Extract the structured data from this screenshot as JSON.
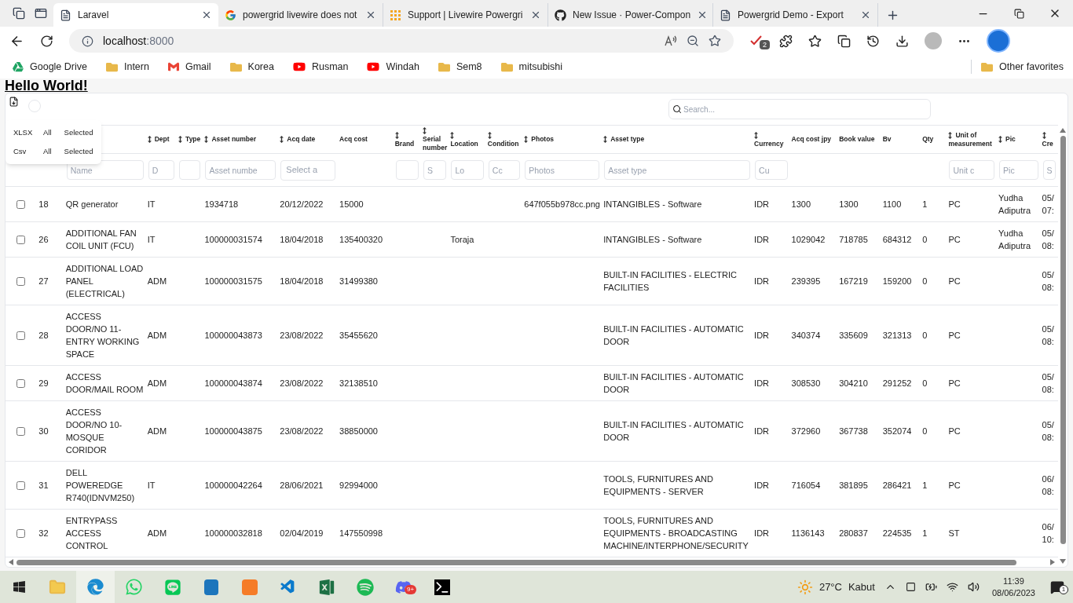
{
  "browser": {
    "tabs": [
      {
        "title": "Laravel",
        "kind": "page",
        "selected": true
      },
      {
        "title": "powergrid livewire does not",
        "kind": "google",
        "selected": false
      },
      {
        "title": "Support | Livewire Powergri",
        "kind": "grid",
        "selected": false
      },
      {
        "title": "New Issue · Power-Compon",
        "kind": "github",
        "selected": false
      },
      {
        "title": "Powergrid Demo - Export",
        "kind": "page",
        "selected": false
      }
    ],
    "address": {
      "host": "localhost",
      "port": ":8000"
    },
    "extension_badge": "2",
    "bookmarks": [
      {
        "label": "Google Drive",
        "kind": "drive"
      },
      {
        "label": "Intern",
        "kind": "folder"
      },
      {
        "label": "Gmail",
        "kind": "gmail"
      },
      {
        "label": "Korea",
        "kind": "folder"
      },
      {
        "label": "Rusman",
        "kind": "youtube"
      },
      {
        "label": "Windah",
        "kind": "youtube"
      },
      {
        "label": "Sem8",
        "kind": "folder"
      },
      {
        "label": "mitsubishi",
        "kind": "folder"
      }
    ],
    "other_favorites": "Other favorites"
  },
  "page": {
    "heading": "Hello World!",
    "export_menu": [
      {
        "format": "XLSX",
        "options": [
          "All",
          "Selected"
        ]
      },
      {
        "format": "Csv",
        "options": [
          "All",
          "Selected"
        ]
      }
    ],
    "search": {
      "placeholder": "Search..."
    },
    "table": {
      "columns": [
        {
          "filter": {
            "kind": "text",
            "placeholder": "Name"
          }
        },
        {
          "label": "Dept",
          "sortable": true,
          "filter": {
            "kind": "text",
            "placeholder": "D"
          }
        },
        {
          "label": "Type",
          "sortable": true,
          "filter": {
            "kind": "text"
          }
        },
        {
          "label": "Asset number",
          "sortable": true,
          "filter": {
            "kind": "text",
            "placeholder": "Asset numbe"
          }
        },
        {
          "label": "Acq date",
          "sortable": true,
          "filter": {
            "kind": "date",
            "placeholder": "Select a"
          }
        },
        {
          "label": "Acq cost",
          "sortable": false
        },
        {
          "label": "Brand",
          "sortable": true,
          "filter": {
            "kind": "text"
          }
        },
        {
          "label": "Serial number",
          "sortable": true,
          "filter": {
            "kind": "text",
            "placeholder": "S"
          }
        },
        {
          "label": "Location",
          "sortable": true,
          "filter": {
            "kind": "text",
            "placeholder": "Lo"
          }
        },
        {
          "label": "Condition",
          "sortable": true,
          "filter": {
            "kind": "text",
            "placeholder": "Cc"
          }
        },
        {
          "label": "Photos",
          "sortable": true,
          "filter": {
            "kind": "text",
            "placeholder": "Photos"
          }
        },
        {
          "label": "Asset type",
          "sortable": true,
          "filter": {
            "kind": "text",
            "placeholder": "Asset type"
          }
        },
        {
          "label": "Currency",
          "sortable": true,
          "filter": {
            "kind": "text",
            "placeholder": "Cu"
          }
        },
        {
          "label": "Acq cost jpy",
          "sortable": false
        },
        {
          "label": "Book value",
          "sortable": false
        },
        {
          "label": "Bv",
          "sortable": false
        },
        {
          "label": "Qty",
          "sortable": false
        },
        {
          "label": "Unit of measurement",
          "sortable": true,
          "filter": {
            "kind": "text",
            "placeholder": "Unit c"
          }
        },
        {
          "label": "Pic",
          "sortable": true,
          "filter": {
            "kind": "text",
            "placeholder": "Pic"
          }
        },
        {
          "label": "Cre",
          "sortable": true,
          "filter": {
            "kind": "text",
            "placeholder": "S"
          }
        }
      ],
      "rows": [
        {
          "selected": false,
          "id": "18",
          "cells": [
            "QR generator",
            "IT",
            null,
            "1934718",
            "20/12/2022",
            "15000",
            null,
            null,
            null,
            null,
            "647f055b978cc.png",
            "INTANGIBLES - Software",
            "IDR",
            "1300",
            "1300",
            "1100",
            "1",
            "PC",
            "Yudha Adiputra",
            "05/ 07:"
          ]
        },
        {
          "selected": false,
          "id": "26",
          "cells": [
            "ADDITIONAL FAN COIL UNIT (FCU)",
            "IT",
            null,
            "100000031574",
            "18/04/2018",
            "135400320",
            null,
            null,
            "Toraja",
            null,
            null,
            "INTANGIBLES - Software",
            "IDR",
            "1029042",
            "718785",
            "684312",
            "0",
            "PC",
            "Yudha Adiputra",
            "05/ 08:"
          ]
        },
        {
          "selected": false,
          "id": "27",
          "cells": [
            "ADDITIONAL LOAD PANEL (ELECTRICAL)",
            "ADM",
            null,
            "100000031575",
            "18/04/2018",
            "31499380",
            null,
            null,
            null,
            null,
            null,
            "BUILT-IN FACILITIES - ELECTRIC FACILITIES",
            "IDR",
            "239395",
            "167219",
            "159200",
            "0",
            "PC",
            null,
            "05/ 08:"
          ]
        },
        {
          "selected": false,
          "id": "28",
          "cells": [
            "ACCESS DOOR/NO 11-ENTRY WORKING SPACE",
            "ADM",
            null,
            "100000043873",
            "23/08/2022",
            "35455620",
            null,
            null,
            null,
            null,
            null,
            "BUILT-IN FACILITIES - AUTOMATIC DOOR",
            "IDR",
            "340374",
            "335609",
            "321313",
            "0",
            "PC",
            null,
            "05/ 08:"
          ]
        },
        {
          "selected": false,
          "id": "29",
          "cells": [
            "ACCESS DOOR/MAIL ROOM",
            "ADM",
            null,
            "100000043874",
            "23/08/2022",
            "32138510",
            null,
            null,
            null,
            null,
            null,
            "BUILT-IN FACILITIES - AUTOMATIC DOOR",
            "IDR",
            "308530",
            "304210",
            "291252",
            "0",
            "PC",
            null,
            "05/ 08:"
          ]
        },
        {
          "selected": false,
          "id": "30",
          "cells": [
            "ACCESS DOOR/NO 10-MOSQUE CORIDOR",
            "ADM",
            null,
            "100000043875",
            "23/08/2022",
            "38850000",
            null,
            null,
            null,
            null,
            null,
            "BUILT-IN FACILITIES - AUTOMATIC DOOR",
            "IDR",
            "372960",
            "367738",
            "352074",
            "0",
            "PC",
            null,
            "05/ 08:"
          ]
        },
        {
          "selected": false,
          "id": "31",
          "cells": [
            "DELL POWEREDGE R740(IDNVM250)",
            "IT",
            null,
            "100000042264",
            "28/06/2021",
            "92994000",
            null,
            null,
            null,
            null,
            null,
            "TOOLS, FURNITURES AND EQUIPMENTS - SERVER",
            "IDR",
            "716054",
            "381895",
            "286421",
            "1",
            "PC",
            null,
            "06/ 08:"
          ]
        },
        {
          "selected": false,
          "id": "32",
          "cells": [
            "ENTRYPASS ACCESS CONTROL",
            "ADM",
            null,
            "100000032818",
            "02/04/2019",
            "147550998",
            null,
            null,
            null,
            null,
            null,
            "TOOLS, FURNITURES AND EQUIPMENTS - BROADCASTING MACHINE/INTERPHONE/SECURITY",
            "IDR",
            "1136143",
            "280837",
            "224535",
            "1",
            "ST",
            null,
            "06/ 10:"
          ]
        }
      ]
    }
  },
  "taskbar": {
    "discord_badge": "9+",
    "weather": {
      "temperature": "27°C",
      "condition": "Kabut"
    },
    "time": "11:39",
    "date": "08/06/2023",
    "notifications": "1"
  }
}
